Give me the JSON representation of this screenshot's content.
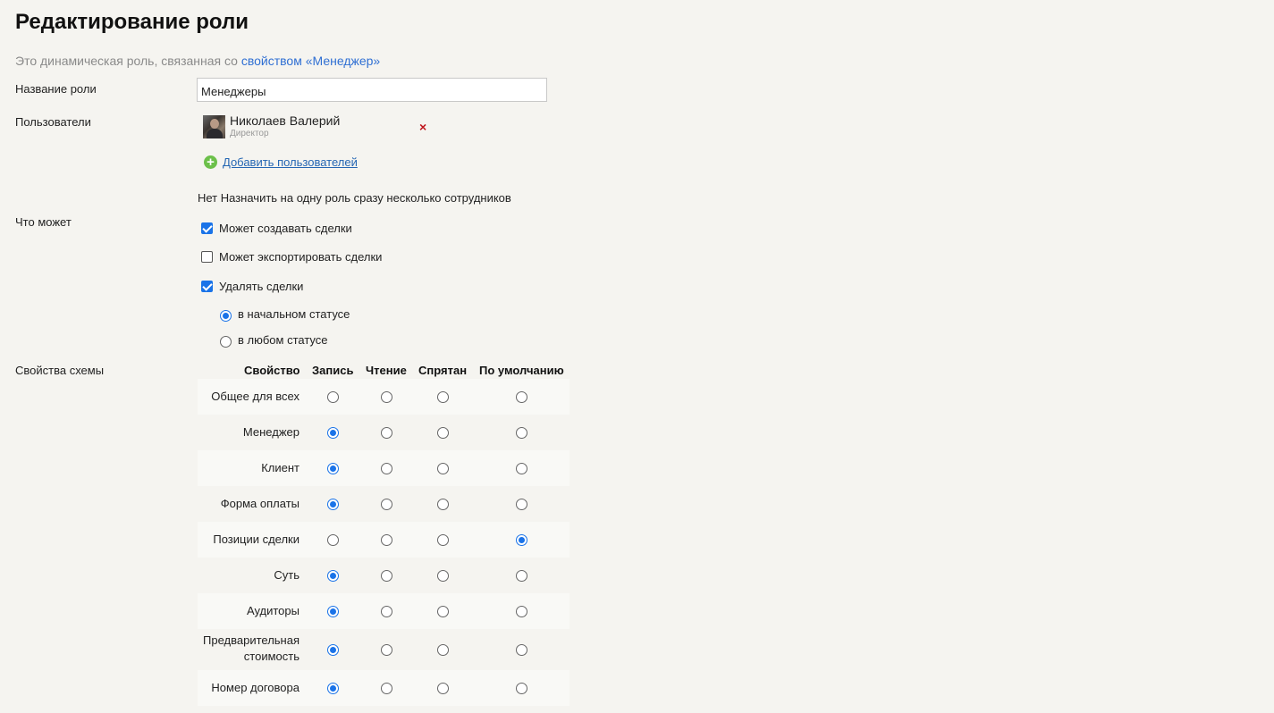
{
  "page": {
    "title": "Редактирование роли",
    "subtitle_prefix": "Это динамическая роль, связанная со ",
    "subtitle_link": "свойством «Менеджер»"
  },
  "form": {
    "role_name_label": "Название роли",
    "role_name_value": "Менеджеры",
    "users_label": "Пользователи",
    "users": [
      {
        "name": "Николаев Валерий",
        "role": "Директор"
      }
    ],
    "remove_icon": "×",
    "add_users_link": "Добавить пользователей",
    "multi_assign_note": "Нет Назначить на одну роль сразу несколько сотрудников",
    "can_do_label": "Что может",
    "permissions": [
      {
        "label": "Может создавать сделки",
        "checked": true
      },
      {
        "label": "Может экспортировать сделки",
        "checked": false
      },
      {
        "label": "Удалять сделки",
        "checked": true
      }
    ],
    "delete_scope": [
      {
        "label": "в начальном статусе",
        "selected": true
      },
      {
        "label": "в любом статусе",
        "selected": false
      }
    ]
  },
  "schema": {
    "label": "Свойства схемы",
    "columns": [
      "Свойство",
      "Запись",
      "Чтение",
      "Спрятан",
      "По умолчанию"
    ],
    "rows": [
      {
        "name": "Общее для всех",
        "selected": null
      },
      {
        "name": "Менеджер",
        "selected": "Запись"
      },
      {
        "name": "Клиент",
        "selected": "Запись"
      },
      {
        "name": "Форма оплаты",
        "selected": "Запись"
      },
      {
        "name": "Позиции сделки",
        "selected": "По умолчанию"
      },
      {
        "name": "Суть",
        "selected": "Запись"
      },
      {
        "name": "Аудиторы",
        "selected": "Запись"
      },
      {
        "name": "Предварительная стоимость",
        "selected": "Запись"
      },
      {
        "name": "Номер договора",
        "selected": "Запись"
      }
    ]
  },
  "colors": {
    "accent": "#1a73e8",
    "link": "#2566b3",
    "add_icon": "#6cc04a",
    "remove_icon": "#c0141c",
    "background": "#f5f4f0"
  }
}
